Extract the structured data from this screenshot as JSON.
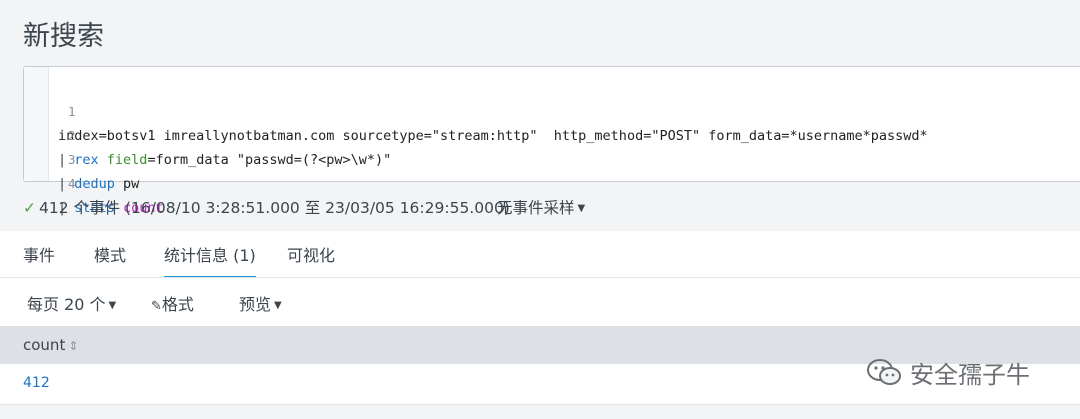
{
  "page": {
    "title": "新搜索"
  },
  "editor": {
    "lines": [
      {
        "num": "1",
        "text": "index=botsv1 imreallynotbatman.com sourcetype=\"stream:http\"  http_method=\"POST\" form_data=*username*passwd*"
      },
      {
        "num": "2",
        "pipe": "| ",
        "cmd": "rex",
        "sp": " ",
        "arg": "field",
        "rest": "=form_data \"passwd=(?<pw>\\w*)\""
      },
      {
        "num": "3",
        "pipe": "| ",
        "cmd": "dedup",
        "rest": " pw"
      },
      {
        "num": "4",
        "pipe": "| ",
        "cmd": "stats",
        "sp": " ",
        "arg": "count"
      }
    ]
  },
  "status": {
    "summary": "412 个事件 (16/08/10 3:28:51.000 至 23/03/05 16:29:55.000)",
    "sampling": "无事件采样"
  },
  "tabs": [
    {
      "label": "事件"
    },
    {
      "label": "模式"
    },
    {
      "label": "统计信息 (1)",
      "active": true
    },
    {
      "label": "可视化"
    }
  ],
  "toolbar": {
    "per_page": "每页 20 个",
    "format": "格式",
    "preview": "预览"
  },
  "table": {
    "columns": [
      "count"
    ],
    "rows": [
      [
        "412"
      ]
    ]
  },
  "watermark": {
    "text": "安全孺子牛"
  },
  "colors": {
    "accent": "#1a9bd6",
    "link": "#1a73c7",
    "success": "#53a051",
    "keyword_arg": "#c026c9"
  }
}
